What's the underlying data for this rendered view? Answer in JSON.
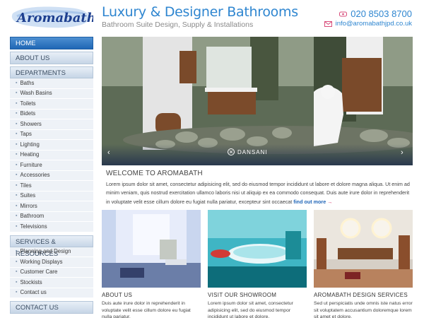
{
  "header": {
    "logo_text": "Aromabath",
    "title": "Luxury & Designer Bathrooms",
    "subtitle": "Bathroom Suite Design, Supply & Installations",
    "phone": "020 8503 8700",
    "email": "info@aromabathjpd.co.uk"
  },
  "sidebar": {
    "home": "HOME",
    "about": "ABOUT US",
    "departments_heading": "DEPARTMENTS",
    "departments": [
      "Baths",
      "Wash Basins",
      "Toilets",
      "Bidets",
      "Showers",
      "Taps",
      "Lighting",
      "Heating",
      "Furniture",
      "Accessories",
      "Tiles",
      "Suites",
      "Mirrors",
      "Bathroom",
      "Televisions"
    ],
    "services_heading": "SERVICES & RESOURCES",
    "services": [
      "Planning and Design",
      "Working Displays",
      "Customer Care",
      "Stockists",
      "Contact us"
    ],
    "contact": "CONTACT US"
  },
  "hero": {
    "brand": "DANSANI",
    "prev": "‹",
    "next": "›"
  },
  "welcome": {
    "title": "WELCOME TO AROMABATH",
    "text": "Lorem ipsum dolor sit amet, consectetur adipisicing elit, sed do eiusmod tempor incididunt ut labore et dolore magna aliqua. Ut enim ad minim veniam, quis nostrud exercitation ullamco laboris nisi ut aliquip ex ea commodo consequat. Duis aute irure dolor in reprehenderit in voluptate velit esse cillum dolore eu fugiat nulla pariatur, excepteur sint occaecat",
    "link": "find out more",
    "link_arrow": "→"
  },
  "cards": [
    {
      "title": "ABOUT US",
      "text": "Duis aute irure dolor in reprehenderit in voluptate velit esse cillum dolore eu fugiat nulla pariatur."
    },
    {
      "title": "VISIT OUR SHOWROOM",
      "text": "Lorem ipsum dolor sit amet, consectetur adipisicing elit, sed do eiusmod tempor incididunt ut labore et dolore."
    },
    {
      "title": "AROMABATH DESIGN SERVICES",
      "text": "Sed ut perspiciatis unde omnis iste natus error sit voluptatem accusantium doloremque lorem sit amet et dolore."
    }
  ],
  "colors": {
    "accent": "#2f86d0",
    "nav_active": "#2067b5",
    "link_arrow": "#d84c7a"
  }
}
